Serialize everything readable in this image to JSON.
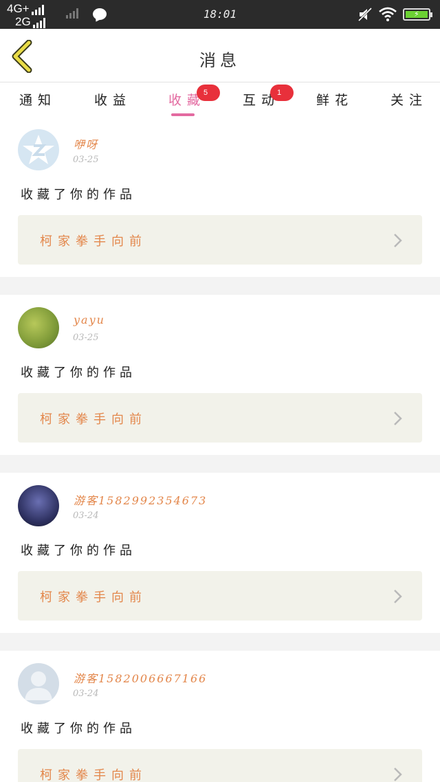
{
  "status_bar": {
    "net_top": "4G+",
    "net_bottom": "2G",
    "time": "18:01"
  },
  "header": {
    "title": "消息"
  },
  "tabs": [
    {
      "label": "通知",
      "badge": ""
    },
    {
      "label": "收益",
      "badge": ""
    },
    {
      "label": "收藏",
      "badge": "5",
      "active": true
    },
    {
      "label": "互动",
      "badge": "1"
    },
    {
      "label": "鲜花",
      "badge": ""
    },
    {
      "label": "关注",
      "badge": ""
    }
  ],
  "messages": [
    {
      "user": "咿呀",
      "date": "03-25",
      "action": "收藏了你的作品",
      "work": "柯家拳手向前",
      "avatar": "qq-icon"
    },
    {
      "user": "yayu",
      "date": "03-25",
      "action": "收藏了你的作品",
      "work": "柯家拳手向前",
      "avatar": "photo"
    },
    {
      "user": "游客1582992354673",
      "date": "03-24",
      "action": "收藏了你的作品",
      "work": "柯家拳手向前",
      "avatar": "photo"
    },
    {
      "user": "游客1582006667166",
      "date": "03-24",
      "action": "收藏了你的作品",
      "work": "柯家拳手向前",
      "avatar": "default-person-icon"
    }
  ],
  "colors": {
    "accent": "#e36aa0",
    "badge": "#e8303b",
    "name": "#e3864a",
    "card_bg": "#f2f2ea"
  }
}
